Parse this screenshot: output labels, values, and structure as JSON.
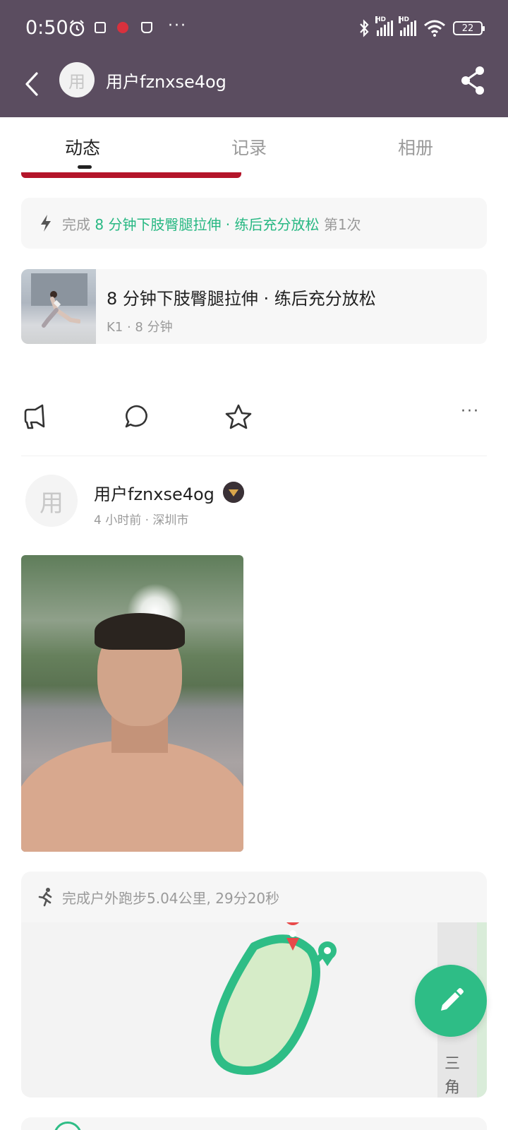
{
  "status_bar": {
    "time": "0:50",
    "battery": "22",
    "network": [
      "HD",
      "HD"
    ],
    "overflow": "···"
  },
  "app_bar": {
    "avatar_text": "用",
    "title": "用户fznxse4og",
    "icons": [
      "back-arrow-icon",
      "share-icon"
    ]
  },
  "tabs": [
    {
      "label": "动态",
      "active": true
    },
    {
      "label": "记录",
      "active": false
    },
    {
      "label": "相册",
      "active": false
    }
  ],
  "workout_done": {
    "prefix": "完成",
    "highlight": "8 分钟下肢臀腿拉伸 · 练后充分放松",
    "suffix": "第1次",
    "accent_color": "#28b883"
  },
  "course": {
    "title": "8 分钟下肢臀腿拉伸 · 练后充分放松",
    "meta": "K1 · 8 分钟"
  },
  "actions": {
    "icons": [
      "cheer-icon",
      "comment-icon",
      "star-icon"
    ],
    "more": "···"
  },
  "post": {
    "avatar_text": "用",
    "username": "用户fznxse4og",
    "meta": "4 小时前 · 深圳市",
    "badge_icon": "level-badge-icon"
  },
  "run": {
    "text": "完成户外跑步5.04公里, 29分20秒",
    "map_label": "三角",
    "route_color": "#2ebd86"
  },
  "fab": {
    "icon": "pencil-icon",
    "color": "#2ebd86"
  }
}
